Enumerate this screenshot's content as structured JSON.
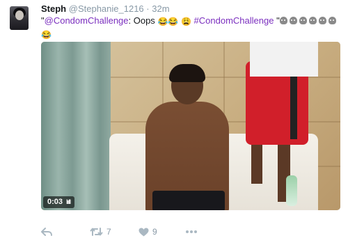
{
  "tweet": {
    "author_name": "Steph",
    "author_handle": "@Stephanie_1216",
    "separator": "·",
    "time": "32m",
    "text": {
      "quote_open": "\"",
      "mention": "@CondomChallenge",
      "body": ": Oops ",
      "laugh_emojis": "😂😂",
      "weary_emoji": "😩",
      "hashtag": "#CondomChallenge",
      "quote_close": " \"",
      "skull_count": 6,
      "trailing_emoji": "😂"
    },
    "media": {
      "duration": "0:03",
      "signal": "lıll"
    },
    "actions": {
      "reply_icon": "reply-icon",
      "retweet_icon": "retweet-icon",
      "retweet_count": "7",
      "like_icon": "heart-icon",
      "like_count": "9",
      "more_icon": "more-icon"
    },
    "colors": {
      "link": "#7b2fbf",
      "icon": "#aab8c2"
    }
  }
}
